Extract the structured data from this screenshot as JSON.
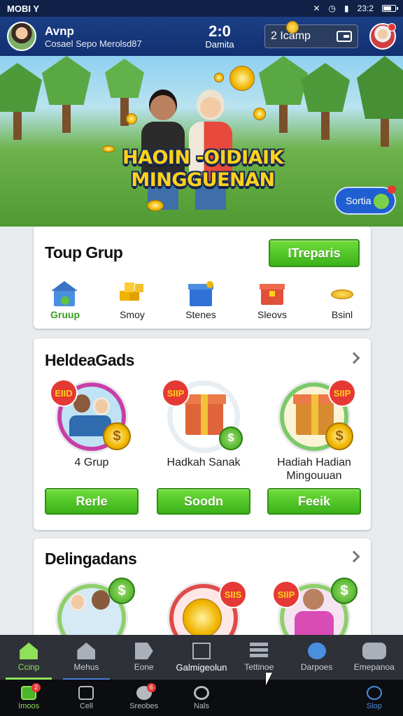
{
  "status_bar": {
    "carrier": "MOBI Y",
    "time": "23:2",
    "icons": [
      "mute-icon",
      "alarm-icon",
      "signal-icon",
      "battery-icon"
    ]
  },
  "header": {
    "user_name": "Avnp",
    "user_subtitle": "Cosael Sepo Merolsd87",
    "score": "2:0",
    "score_label": "Damita",
    "coin_text": "2 Icamp",
    "avatar_icon": "user-avatar",
    "wallet_icon": "wallet-icon"
  },
  "banner": {
    "title_line1": "HAOIN -OIDIAIK",
    "title_line2": "MINGGUENAN",
    "sortia_label": "Sortia"
  },
  "top_group": {
    "title": "Toup Grup",
    "action_label": "ITreparis",
    "categories": [
      {
        "label": "Gruup",
        "icon": "house-icon"
      },
      {
        "label": "Smoy",
        "icon": "gold-blocks-icon"
      },
      {
        "label": "Stenes",
        "icon": "blue-box-icon"
      },
      {
        "label": "Sleovs",
        "icon": "red-box-icon"
      },
      {
        "label": "Bsinl",
        "icon": "coin-stack-icon"
      }
    ]
  },
  "hadiah": {
    "title": "HeldeaGads",
    "items": [
      {
        "badge": "EIID",
        "label": "4 Grup",
        "button": "Rerle"
      },
      {
        "badge": "SIIP",
        "label": "Hadkah Sanak",
        "button": "Soodn"
      },
      {
        "badge": "SIIP",
        "label": "Hadiah Hadian Mingouuan",
        "button": "Feeik"
      }
    ]
  },
  "delingadans": {
    "title": "Delingadans",
    "items": [
      {
        "badge": ""
      },
      {
        "badge": "SIIS"
      },
      {
        "badge": "SIIP"
      }
    ]
  },
  "nav_primary": [
    {
      "label": "Ccinp",
      "icon": "home-icon",
      "active": true
    },
    {
      "label": "Mehus",
      "icon": "house-icon",
      "active": false
    },
    {
      "label": "Eone",
      "icon": "tag-icon",
      "active": false
    },
    {
      "label": "Galmigeolun",
      "icon": "cards-icon",
      "active": false
    },
    {
      "label": "Tettinoe",
      "icon": "stack-icon",
      "active": false
    },
    {
      "label": "Darpoes",
      "icon": "globe-icon",
      "active": false
    },
    {
      "label": "Emepanoa",
      "icon": "gamepad-icon",
      "active": false
    }
  ],
  "nav_secondary": [
    {
      "label": "Imoos",
      "icon": "home-icon",
      "badge": "2"
    },
    {
      "label": "Cell",
      "icon": "phone-icon",
      "badge": ""
    },
    {
      "label": "Sreobes",
      "icon": "users-icon",
      "badge": "6"
    },
    {
      "label": "Nals",
      "icon": "refresh-icon",
      "badge": ""
    },
    {
      "label": "",
      "icon": "",
      "badge": ""
    },
    {
      "label": "",
      "icon": "",
      "badge": ""
    },
    {
      "label": "Slop",
      "icon": "globe-icon",
      "badge": ""
    }
  ]
}
